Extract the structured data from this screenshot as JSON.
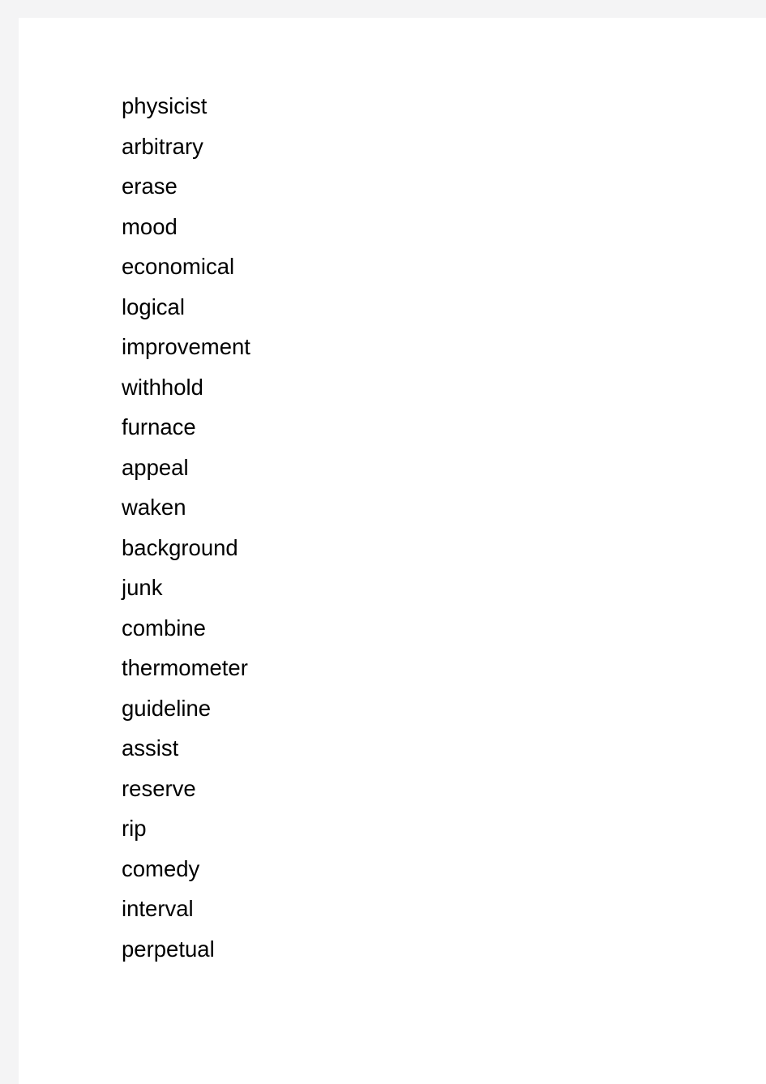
{
  "page": {
    "background_color": "#f4f4f5",
    "surface_color": "#ffffff",
    "text_color": "#000000"
  },
  "word_list": {
    "items": [
      {
        "text": "physicist"
      },
      {
        "text": "arbitrary"
      },
      {
        "text": "erase"
      },
      {
        "text": "mood"
      },
      {
        "text": "economical"
      },
      {
        "text": "logical"
      },
      {
        "text": "improvement"
      },
      {
        "text": "withhold"
      },
      {
        "text": "furnace"
      },
      {
        "text": "appeal"
      },
      {
        "text": "waken"
      },
      {
        "text": "background"
      },
      {
        "text": "junk"
      },
      {
        "text": "combine"
      },
      {
        "text": "thermometer"
      },
      {
        "text": "guideline"
      },
      {
        "text": "assist"
      },
      {
        "text": "reserve"
      },
      {
        "text": "rip"
      },
      {
        "text": "comedy"
      },
      {
        "text": "interval"
      },
      {
        "text": "perpetual"
      }
    ]
  }
}
